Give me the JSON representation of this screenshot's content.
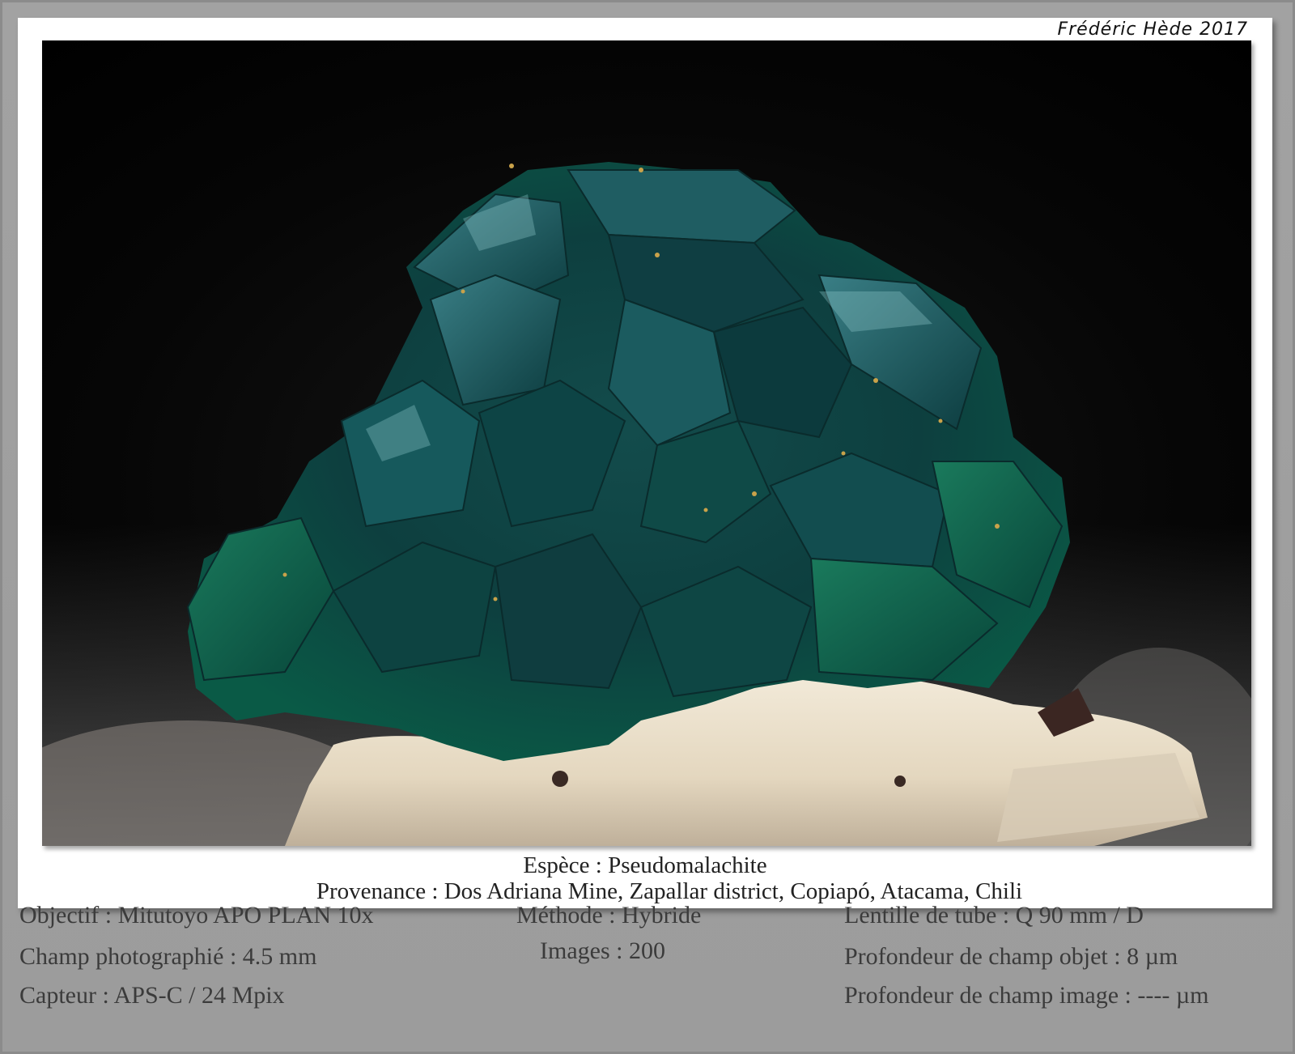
{
  "signature": "Frédéric Hède 2017",
  "caption": {
    "species": "Espèce : Pseudomalachite",
    "origin": "Provenance : Dos Adriana Mine, Zapallar district, Copiapó, Atacama, Chili"
  },
  "specs": {
    "col1": [
      "Objectif : Mitutoyo APO PLAN 10x",
      "Champ photographié : 4.5 mm",
      "Capteur : APS-C / 24 Mpix"
    ],
    "col2": [
      "Méthode : Hybride",
      "Images : 200"
    ],
    "col3": [
      "Lentille de tube : Q 90 mm / D",
      "Profondeur de champ objet : 8 µm",
      "Profondeur de champ image : ---- µm"
    ]
  },
  "colors": {
    "frame": "#9a9a9a",
    "card": "#ffffff",
    "background": "#050505",
    "crystal": "#0e5a55",
    "matrix": "#ece2cf"
  }
}
